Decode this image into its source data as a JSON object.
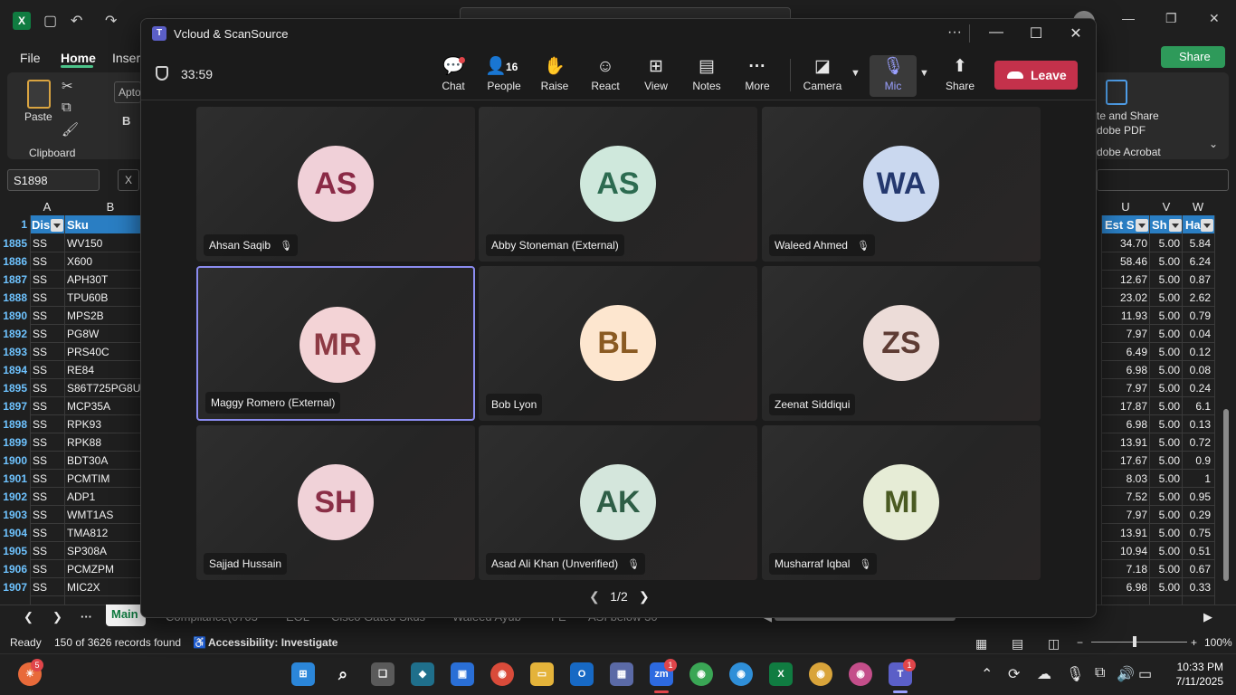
{
  "excel": {
    "logo": "X",
    "ribbon_tabs": [
      "File",
      "Home",
      "Insert"
    ],
    "active_tab": "Home",
    "share_label": "Share",
    "clipboard": {
      "paste_label": "Paste",
      "group_label": "Clipboard"
    },
    "font_box": "Apto",
    "bold_label": "B",
    "adobe": {
      "line1": "te and Share",
      "line2": "dobe PDF",
      "group_label": "dobe Acrobat"
    },
    "name_box": "S1898",
    "fx_label": "X",
    "columns_left": [
      "A",
      "B"
    ],
    "columns_right": [
      "U",
      "V",
      "W"
    ],
    "header_row_num": "1",
    "headers_left": [
      "Dis",
      "Sku"
    ],
    "headers_right": [
      "Est S",
      "Sh",
      "Ha"
    ],
    "rows": [
      {
        "num": "1885",
        "a": "SS",
        "b": "WV150",
        "u": "34.70",
        "v": "5.00",
        "w": "5.84"
      },
      {
        "num": "1886",
        "a": "SS",
        "b": "X600",
        "u": "58.46",
        "v": "5.00",
        "w": "6.24"
      },
      {
        "num": "1887",
        "a": "SS",
        "b": "APH30T",
        "u": "12.67",
        "v": "5.00",
        "w": "0.87"
      },
      {
        "num": "1888",
        "a": "SS",
        "b": "TPU60B",
        "u": "23.02",
        "v": "5.00",
        "w": "2.62"
      },
      {
        "num": "1890",
        "a": "SS",
        "b": "MPS2B",
        "u": "11.93",
        "v": "5.00",
        "w": "0.79"
      },
      {
        "num": "1892",
        "a": "SS",
        "b": "PG8W",
        "u": "7.97",
        "v": "5.00",
        "w": "0.04"
      },
      {
        "num": "1893",
        "a": "SS",
        "b": "PRS40C",
        "u": "6.49",
        "v": "5.00",
        "w": "0.12"
      },
      {
        "num": "1894",
        "a": "SS",
        "b": "RE84",
        "u": "6.98",
        "v": "5.00",
        "w": "0.08"
      },
      {
        "num": "1895",
        "a": "SS",
        "b": "S86T725PG8U",
        "u": "7.97",
        "v": "5.00",
        "w": "0.24"
      },
      {
        "num": "1897",
        "a": "SS",
        "b": "MCP35A",
        "u": "17.87",
        "v": "5.00",
        "w": "6.1"
      },
      {
        "num": "1898",
        "a": "SS",
        "b": "RPK93",
        "u": "6.98",
        "v": "5.00",
        "w": "0.13"
      },
      {
        "num": "1899",
        "a": "SS",
        "b": "RPK88",
        "u": "13.91",
        "v": "5.00",
        "w": "0.72"
      },
      {
        "num": "1900",
        "a": "SS",
        "b": "BDT30A",
        "u": "17.67",
        "v": "5.00",
        "w": "0.9"
      },
      {
        "num": "1901",
        "a": "SS",
        "b": "PCMTIM",
        "u": "8.03",
        "v": "5.00",
        "w": "1"
      },
      {
        "num": "1902",
        "a": "SS",
        "b": "ADP1",
        "u": "7.52",
        "v": "5.00",
        "w": "0.95"
      },
      {
        "num": "1903",
        "a": "SS",
        "b": "WMT1AS",
        "u": "7.97",
        "v": "5.00",
        "w": "0.29"
      },
      {
        "num": "1904",
        "a": "SS",
        "b": "TMA812",
        "u": "13.91",
        "v": "5.00",
        "w": "0.75"
      },
      {
        "num": "1905",
        "a": "SS",
        "b": "SP308A",
        "u": "10.94",
        "v": "5.00",
        "w": "0.51"
      },
      {
        "num": "1906",
        "a": "SS",
        "b": "PCMZPM",
        "u": "7.18",
        "v": "5.00",
        "w": "0.67"
      },
      {
        "num": "1907",
        "a": "SS",
        "b": "MIC2X",
        "u": "6.98",
        "v": "5.00",
        "w": "0.33"
      }
    ],
    "sheets": [
      "Main",
      "Compliance(0703",
      "EOL",
      "Cisco Gated Skus",
      "Waleed Ayub",
      "FE",
      "ASI below 30"
    ],
    "active_sheet": "Main",
    "status": {
      "ready": "Ready",
      "records": "150 of 3626 records found",
      "accessibility": "Accessibility: Investigate",
      "zoom": "100%"
    }
  },
  "teams": {
    "logo": "T",
    "window_title": "Vcloud & ScanSource",
    "timer": "33:59",
    "people_count": "16",
    "tools": [
      {
        "key": "chat",
        "label": "Chat",
        "icon": "chat-icon",
        "glyph": "💬"
      },
      {
        "key": "people",
        "label": "People",
        "icon": "people-icon",
        "glyph": "👤"
      },
      {
        "key": "raise",
        "label": "Raise",
        "icon": "hand-icon",
        "glyph": "✋"
      },
      {
        "key": "react",
        "label": "React",
        "icon": "smiley-icon",
        "glyph": "☺"
      },
      {
        "key": "view",
        "label": "View",
        "icon": "grid-icon",
        "glyph": "⊞"
      },
      {
        "key": "notes",
        "label": "Notes",
        "icon": "notes-icon",
        "glyph": "▤"
      },
      {
        "key": "more",
        "label": "More",
        "icon": "ellipsis-icon",
        "glyph": "···"
      },
      {
        "key": "camera",
        "label": "Camera",
        "icon": "camera-off-icon",
        "glyph": "◪"
      },
      {
        "key": "mic",
        "label": "Mic",
        "icon": "mic-off-icon",
        "glyph": "🎙"
      },
      {
        "key": "share",
        "label": "Share",
        "icon": "share-screen-icon",
        "glyph": "⬆"
      }
    ],
    "leave_label": "Leave",
    "participants": [
      {
        "initials": "AS",
        "name": "Ahsan Saqib",
        "muted": true,
        "bg": "#f0d0d8",
        "fg": "#8a2a46"
      },
      {
        "initials": "AS",
        "name": "Abby Stoneman (External)",
        "muted": false,
        "bg": "#cfe8dc",
        "fg": "#2c6b50"
      },
      {
        "initials": "WA",
        "name": "Waleed Ahmed",
        "muted": true,
        "bg": "#cad8ef",
        "fg": "#24386e"
      },
      {
        "initials": "MR",
        "name": "Maggy Romero (External)",
        "muted": false,
        "bg": "#f3d3d6",
        "fg": "#8d3a44"
      },
      {
        "initials": "BL",
        "name": "Bob Lyon",
        "muted": false,
        "bg": "#fde6cf",
        "fg": "#8a5a22"
      },
      {
        "initials": "ZS",
        "name": "Zeenat Siddiqui",
        "muted": false,
        "bg": "#ecdcd8",
        "fg": "#5e3c34"
      },
      {
        "initials": "SH",
        "name": "Sajjad Hussain",
        "muted": false,
        "bg": "#f0d2d8",
        "fg": "#8a2f47"
      },
      {
        "initials": "AK",
        "name": "Asad Ali Khan (Unverified)",
        "muted": true,
        "bg": "#d4e6dc",
        "fg": "#2e5e46"
      },
      {
        "initials": "MI",
        "name": "Musharraf Iqbal",
        "muted": true,
        "bg": "#e6ecd6",
        "fg": "#4a5a22"
      }
    ],
    "pager": "1/2"
  },
  "taskbar": {
    "weather_badge": "5",
    "zoom_badge": "1",
    "teams_badge": "1",
    "time": "10:33 PM",
    "date": "7/11/2025"
  },
  "colors": {
    "excel_accent": "#107c41",
    "table_header": "#2a7ec3",
    "teams_accent": "#8b8cf0",
    "leave": "#c4314b"
  }
}
